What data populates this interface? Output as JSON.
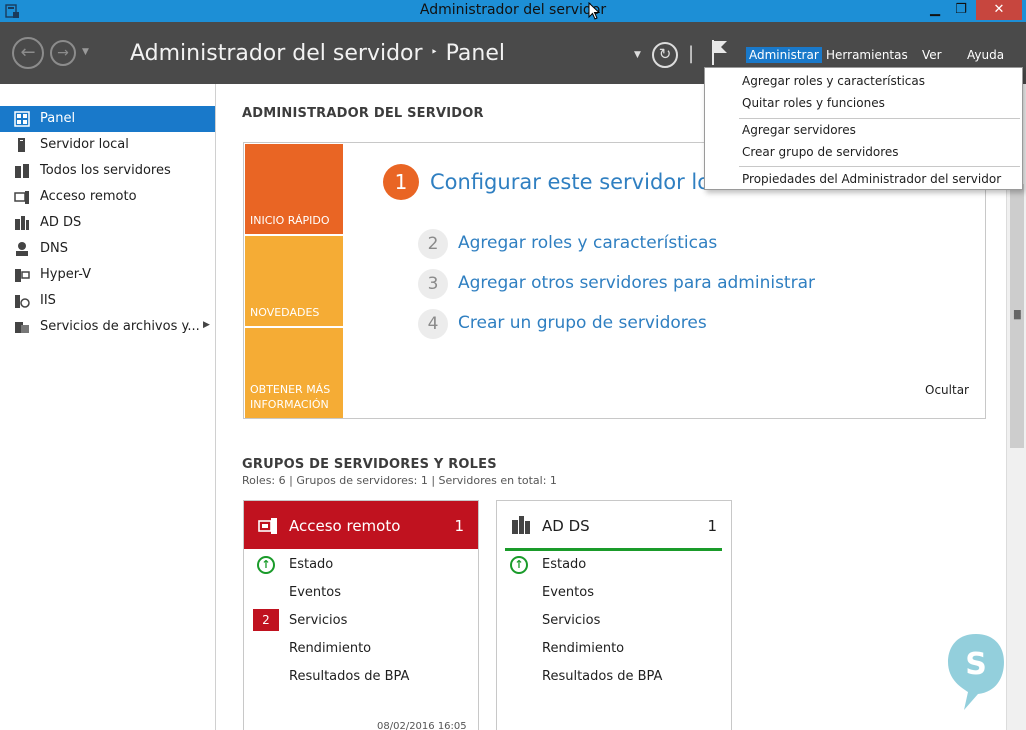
{
  "window": {
    "title": "Administrador del servidor",
    "minimize": "▁",
    "restore": "❐",
    "close": "✕"
  },
  "header": {
    "breadcrumb_root": "Administrador del servidor",
    "breadcrumb_sep": "‣",
    "breadcrumb_current": "Panel",
    "menu": {
      "administrar": "Administrar",
      "herramientas": "Herramientas",
      "ver": "Ver",
      "ayuda": "Ayuda"
    }
  },
  "sidebar": {
    "items": [
      {
        "label": "Panel",
        "icon": "dashboard-icon",
        "selected": true
      },
      {
        "label": "Servidor local",
        "icon": "server-icon"
      },
      {
        "label": "Todos los servidores",
        "icon": "servers-icon"
      },
      {
        "label": "Acceso remoto",
        "icon": "remote-access-icon"
      },
      {
        "label": "AD DS",
        "icon": "ad-ds-icon"
      },
      {
        "label": "DNS",
        "icon": "dns-icon"
      },
      {
        "label": "Hyper-V",
        "icon": "hyper-v-icon"
      },
      {
        "label": "IIS",
        "icon": "iis-icon"
      },
      {
        "label": "Servicios de archivos y...",
        "icon": "file-services-icon"
      }
    ]
  },
  "main": {
    "section_title": "ADMINISTRADOR DEL SERVIDOR",
    "quickstart": {
      "tiles": {
        "inicio": "INICIO RÁPIDO",
        "novedades": "NOVEDADES",
        "obtener_line1": "OBTENER MÁS",
        "obtener_line2": "INFORMACIÓN"
      },
      "step1_num": "1",
      "step1_label": "Configurar este servidor local",
      "steps": [
        {
          "num": "2",
          "label": "Agregar roles y características"
        },
        {
          "num": "3",
          "label": "Agregar otros servidores para administrar"
        },
        {
          "num": "4",
          "label": "Crear un grupo de servidores"
        }
      ],
      "hide": "Ocultar"
    },
    "groups_title": "GRUPOS DE SERVIDORES Y ROLES",
    "groups_info": "Roles: 6   |   Grupos de servidores: 1   |   Servidores en total: 1",
    "cards": [
      {
        "title": "Acceso remoto",
        "count": "1",
        "rows": [
          "Estado",
          "Eventos",
          "Servicios",
          "Rendimiento",
          "Resultados de BPA"
        ],
        "services_badge": "2",
        "date": "08/02/2016 16:05",
        "header_color": "#c0121f"
      },
      {
        "title": "AD DS",
        "count": "1",
        "rows": [
          "Estado",
          "Eventos",
          "Servicios",
          "Rendimiento",
          "Resultados de BPA"
        ],
        "accent_color": "#1a9b2a"
      }
    ]
  },
  "dropdown": {
    "items": [
      "Agregar roles y características",
      "Quitar roles y funciones",
      "Agregar servidores",
      "Crear grupo de servidores",
      "Propiedades del Administrador del servidor"
    ]
  },
  "colors": {
    "titlebar": "#1d8fd6",
    "header": "#4a4a4a",
    "accent": "#1979ca",
    "orange": "#e96524",
    "tile_yellow": "#f5ac35"
  }
}
